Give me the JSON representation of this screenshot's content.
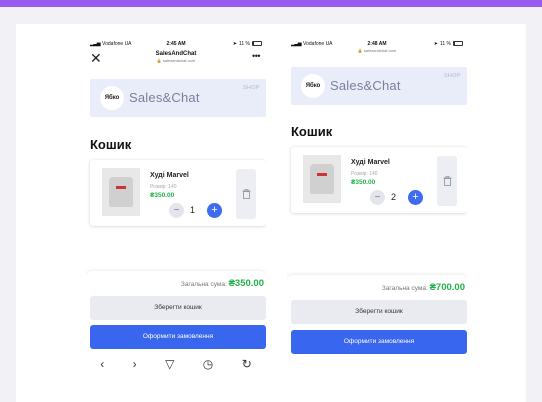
{
  "screens": [
    {
      "status": {
        "carrier": "Vodafone UA",
        "time": "2:45 AM",
        "battery": "11 %"
      },
      "title": "SalesAndChat",
      "url": "salesandchat.com",
      "banner": {
        "logo": "Ябко",
        "brand": "Sales&Chat",
        "tag": "SHOP"
      },
      "heading": "Кошик",
      "item": {
        "name": "Худі Marvel",
        "size": "Розмір: 140",
        "price": "₴350.00",
        "qty": "1"
      },
      "total_label": "Загальна сума:",
      "total_value": "₴350.00",
      "save_button": "Зберегти кошик",
      "order_button": "Оформити замовлення"
    },
    {
      "status": {
        "carrier": "Vodafone UA",
        "time": "2:48 AM",
        "battery": "11 %"
      },
      "url": "salesandchat.com",
      "banner": {
        "logo": "Ябко",
        "brand": "Sales&Chat",
        "tag": "SHOP"
      },
      "heading": "Кошик",
      "item": {
        "name": "Худі Marvel",
        "size": "Розмір: 140",
        "price": "₴350.00",
        "qty": "2"
      },
      "total_label": "Загальна сума:",
      "total_value": "₴700.00",
      "save_button": "Зберегти кошик",
      "order_button": "Оформити замовлення"
    }
  ],
  "icons": {
    "close": "close-icon",
    "more": "more-icon",
    "trash": "trash-icon",
    "back": "back-icon",
    "forward": "forward-icon",
    "share": "send-icon",
    "history": "history-icon",
    "reload": "reload-icon"
  },
  "colors": {
    "accent": "#3966ee",
    "price": "#22b14c",
    "frame": "#9a5cf0"
  }
}
